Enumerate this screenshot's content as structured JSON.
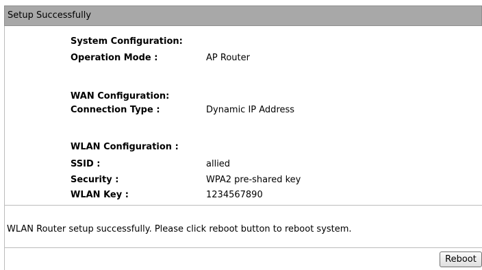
{
  "header": {
    "title": "Setup Successfully"
  },
  "system": {
    "section_label": "System Configuration:",
    "operation_mode_label": "Operation Mode :",
    "operation_mode_value": "AP Router"
  },
  "wan": {
    "section_label": "WAN Configuration:",
    "connection_type_label": "Connection Type :",
    "connection_type_value": "Dynamic IP Address"
  },
  "wlan": {
    "section_label": "WLAN Configuration :",
    "ssid_label": "SSID :",
    "ssid_value": "allied",
    "security_label": "Security :",
    "security_value": "WPA2 pre-shared key",
    "key_label": "WLAN Key :",
    "key_value": "1234567890"
  },
  "message": {
    "text": "WLAN Router setup successfully. Please click reboot button to reboot system."
  },
  "footer": {
    "reboot_label": "Reboot"
  }
}
